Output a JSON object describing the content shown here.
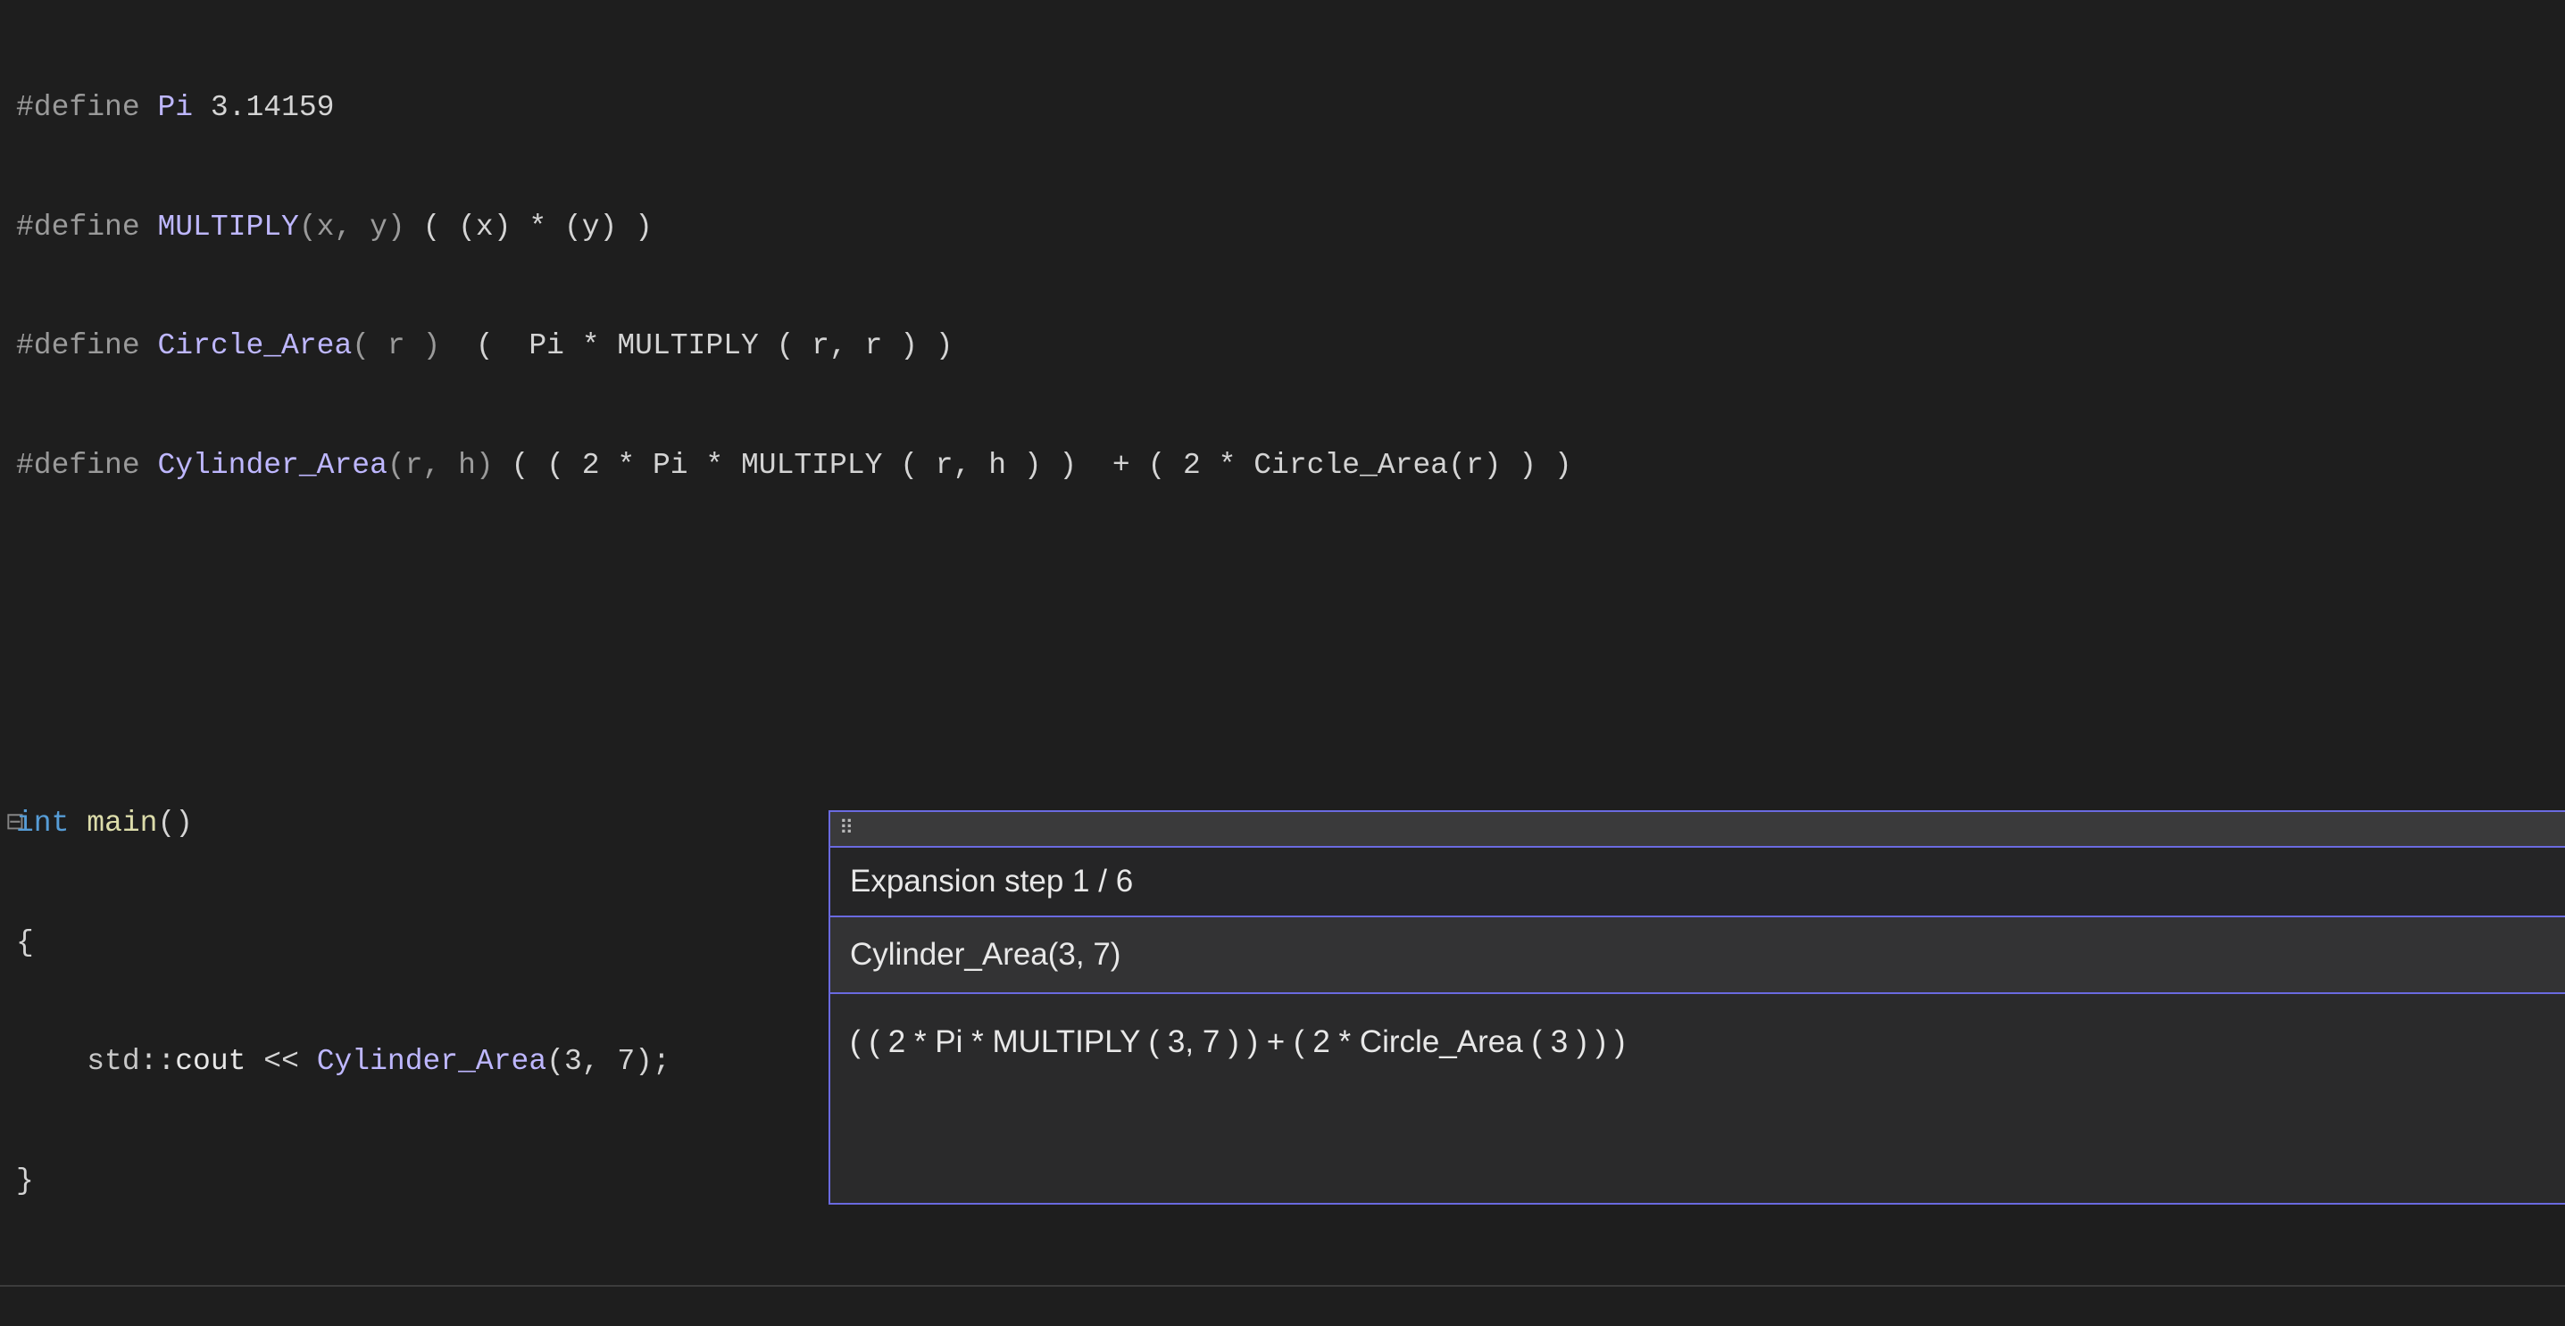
{
  "code": {
    "line1": {
      "pre": "#define ",
      "name": "Pi",
      "rest": " 3.14159"
    },
    "line2": {
      "pre": "#define ",
      "name": "MULTIPLY",
      "args": "(x, y)",
      "body": " ( (x) * (y) )"
    },
    "line3": {
      "pre": "#define ",
      "name": "Circle_Area",
      "args": "( r )",
      "body": "  (  Pi * MULTIPLY ( r, r ) )"
    },
    "line4": {
      "pre": "#define ",
      "name": "Cylinder_Area",
      "args": "(r, h)",
      "body": " ( ( 2 * Pi * MULTIPLY ( r, h ) )  + ( 2 * Circle_Area(r) ) )"
    },
    "line7_kw": "int ",
    "line7_fn": "main",
    "line7_paren": "()",
    "line8": "{",
    "line9_indent": "    ",
    "line9_ns": "std",
    "line9_scope": "::",
    "line9_cout": "cout",
    "line9_op": " << ",
    "line9_macro": "Cylinder_Area",
    "line9_args": "(3, 7)",
    "line9_semi": ";",
    "line10": "}"
  },
  "popup": {
    "title": "Expansion step 1 / 6",
    "macro_call": "Cylinder_Area(3, 7)",
    "expansion": "( ( 2 * Pi * MULTIPLY ( 3, 7 ) ) + ( 2 * Circle_Area ( 3 ) ) )"
  }
}
